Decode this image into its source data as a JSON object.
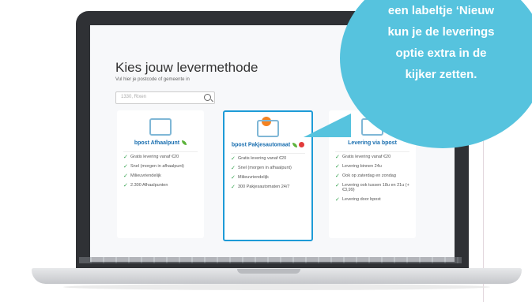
{
  "left_fragment": "e",
  "callout": {
    "lines": [
      "een labeltje ‘Nieuw",
      "kun je de leverings",
      "optie extra in de",
      "kijker zetten."
    ]
  },
  "page": {
    "title": "Kies jouw levermethode",
    "subtitle": "Vul hier je postcode of gemeente in",
    "search_placeholder": "1330, Rixen"
  },
  "cards": [
    {
      "title": "bpost Afhaalpunt",
      "features": [
        "Gratis levering vanaf €20",
        "Snel (morgen in afhaalpunt)",
        "Milieuvriendelijk",
        "2.300 Afhaalpunten"
      ]
    },
    {
      "title": "bpost Pakjesautomaat",
      "features": [
        "Gratis levering vanaf €20",
        "Snel (morgen in afhaalpunt)",
        "Milieuvriendelijk",
        "300 Pakjesautomaten 24/7"
      ]
    },
    {
      "title": "Levering via bpost",
      "features": [
        "Gratis levering vanaf €20",
        "Levering binnen 24u",
        "Ook op zaterdag en zondag",
        "Levering ook tussen 18u en 21u (+€3,99)",
        "Levering door bpost"
      ]
    }
  ],
  "colors": {
    "accent": "#1e9bd7",
    "bubble": "#56c3de",
    "eco": "#5cb23a"
  }
}
